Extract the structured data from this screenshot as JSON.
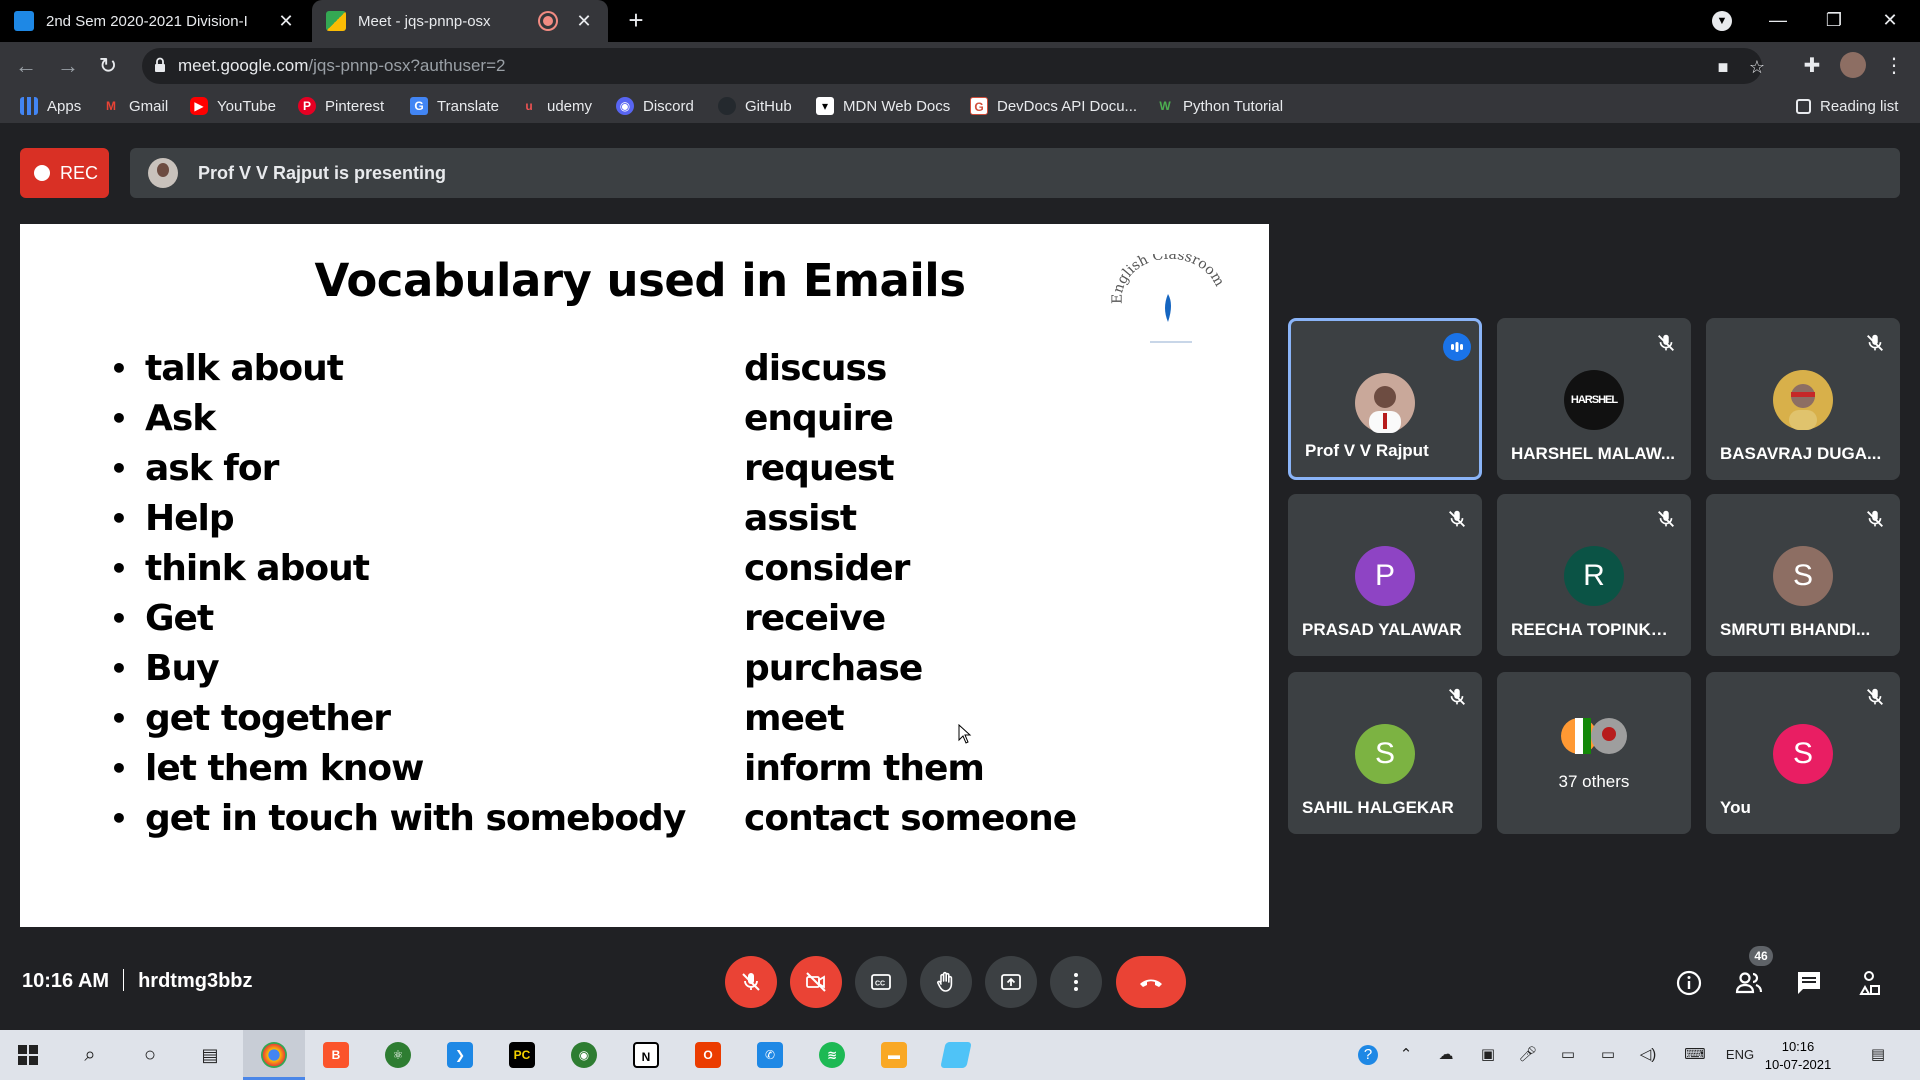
{
  "browser": {
    "tabs": [
      {
        "title": "2nd Sem 2020-2021 Division-I",
        "active": false
      },
      {
        "title": "Meet - jqs-pnnp-osx",
        "active": true
      }
    ],
    "url_host": "meet.google.com",
    "url_path": "/jqs-pnnp-osx?authuser=2",
    "bookmarks": [
      {
        "label": "Apps",
        "icon": "apps-grid-icon",
        "color": "#4285f4"
      },
      {
        "label": "Gmail",
        "icon": "gmail-icon",
        "color": "#ea4335"
      },
      {
        "label": "YouTube",
        "icon": "youtube-icon",
        "color": "#ff0000"
      },
      {
        "label": "Pinterest",
        "icon": "pinterest-icon",
        "color": "#e60023"
      },
      {
        "label": "Translate",
        "icon": "translate-icon",
        "color": "#4285f4"
      },
      {
        "label": "udemy",
        "icon": "udemy-icon",
        "color": "#a435f0"
      },
      {
        "label": "Discord",
        "icon": "discord-icon",
        "color": "#5865f2"
      },
      {
        "label": "GitHub",
        "icon": "github-icon",
        "color": "#24292e"
      },
      {
        "label": "MDN Web Docs",
        "icon": "mdn-icon",
        "color": "#1b1b1b"
      },
      {
        "label": "DevDocs API Docu...",
        "icon": "devdocs-icon",
        "color": "#d14d3a"
      },
      {
        "label": "Python Tutorial",
        "icon": "python-icon",
        "color": "#2e7d32"
      }
    ],
    "reading_list": "Reading list"
  },
  "meet": {
    "rec_label": "REC",
    "presenting_text": "Prof V V Rajput is presenting",
    "slide": {
      "title": "Vocabulary used in Emails",
      "logo_text": "English Classroom",
      "left_items": [
        "talk about",
        "Ask",
        "ask for",
        "Help",
        "think about",
        "Get",
        "Buy",
        "get together",
        "let them know",
        "get in touch with somebody"
      ],
      "right_items": [
        "discuss",
        "enquire",
        "request",
        "assist",
        "consider",
        "receive",
        "purchase",
        "meet",
        "inform them",
        "contact someone"
      ]
    },
    "participants": [
      {
        "name": "Prof V V Rajput",
        "initial": "",
        "color": "#c9a89a",
        "speaking": true,
        "muted": false
      },
      {
        "name": "HARSHEL MALAW...",
        "initial": "HARSHEL",
        "color": "#111111",
        "speaking": false,
        "muted": true
      },
      {
        "name": "BASAVRAJ DUGA...",
        "initial": "",
        "color": "#d8b04a",
        "speaking": false,
        "muted": true
      },
      {
        "name": "PRASAD YALAWAR",
        "initial": "P",
        "color": "#8e44c4",
        "speaking": false,
        "muted": true
      },
      {
        "name": "REECHA TOPINKA...",
        "initial": "R",
        "color": "#0b5345",
        "speaking": false,
        "muted": true
      },
      {
        "name": "SMRUTI BHANDI...",
        "initial": "S",
        "color": "#8d6e63",
        "speaking": false,
        "muted": true
      },
      {
        "name": "SAHIL HALGEKAR",
        "initial": "S",
        "color": "#7cb342",
        "speaking": false,
        "muted": true
      },
      {
        "name": "37 others",
        "initial": "",
        "color": "#3c4043",
        "speaking": false,
        "muted": false
      },
      {
        "name": "You",
        "initial": "S",
        "color": "#e91e63",
        "speaking": false,
        "muted": true
      }
    ],
    "time": "10:16 AM",
    "meeting_code": "hrdtmg3bbz",
    "participant_count": "46"
  },
  "taskbar": {
    "lang": "ENG",
    "time": "10:16",
    "date": "10-07-2021"
  }
}
